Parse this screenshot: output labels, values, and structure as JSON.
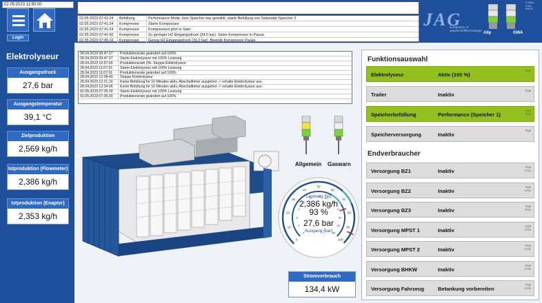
{
  "header": {
    "datetime": "02.05.2023 11:50:00",
    "login_label": "Login",
    "logo_text": "JAG",
    "logo_subtitle": "kompetenz in wasserstofftechnologie",
    "light_labels": [
      "Allp",
      "GWA"
    ],
    "status_tiny": "0.0Sec\n0.0m\nKSG3"
  },
  "top_log": [
    {
      "time": "02.05.2023 07:41:24",
      "source": "Befüllung",
      "message": "Performance Mode, kein Speicher war gewählt, starte Befüllung von Sekundär-Speicher 2"
    },
    {
      "time": "02.05.2023 07:41:24",
      "source": "Kompressor",
      "message": "Starte Kompressor"
    },
    {
      "time": "02.05.2023 07:41:24",
      "source": "Kompressor",
      "message": "Kompression jetzt in Start"
    },
    {
      "time": "02.05.2023 07:41:50",
      "source": "Kompressor",
      "message": "Zu geringer H2 Eingangsdruck (24,0 bar). Setze Kompressor in Pause."
    },
    {
      "time": "02.05.2023 07:45:16",
      "source": "Kompressor",
      "message": "Genug H2 Eingangsdruck (31,0 bar). Beende Kompressor Pause."
    }
  ],
  "left": {
    "title": "Elektrolyseur",
    "measures": [
      {
        "label": "Ausgangsdruck",
        "value": "27,6 bar"
      },
      {
        "label": "Ausgangstemperatur",
        "value": "39,1 °C"
      },
      {
        "label": "Zielproduktion",
        "value": "2,569 kg/h"
      },
      {
        "label": "Istproduktion (Flowmeter)",
        "value": "2,386 kg/h"
      },
      {
        "label": "Istproduktion (Enapter)",
        "value": "2,353 kg/h"
      }
    ]
  },
  "main_log": [
    {
      "time": "28.04.2023 09:47:37",
      "message": "Produktionsrate geändert auf 100%"
    },
    {
      "time": "28.04.2023 09:47:37",
      "message": "Starte Elektrolyseur mit 100% Leistung"
    },
    {
      "time": "28.04.2023 10:57:55",
      "message": "Produktionsrate 0%. Stoppe Elektrolyseur"
    },
    {
      "time": "28.04.2023 11:07:01",
      "message": "Starte Elektrolyseur mit 100% Leistung"
    },
    {
      "time": "28.04.2023 11:07:01",
      "message": "Produktionsrate geändert auf 100%"
    },
    {
      "time": "28.04.2023 12:08:40",
      "message": "Stoppe Elektrolyseur"
    },
    {
      "time": "28.04.2023 12:21:16",
      "message": "Keine Befüllung für 10 Minuten aktiv, Abschalttimer ausgelöst -> schalte Elektrolyseur aus."
    },
    {
      "time": "28.04.2023 12:34:06",
      "message": "Keine Befüllung für 10 Minuten aktiv, Abschalttimer ausgelöst -> schalte Elektrolyseur aus."
    },
    {
      "time": "02.05.2023 07:35:30",
      "message": "Starte Elektrolyseur mit 100% Leistung"
    },
    {
      "time": "02.05.2023 07:35:30",
      "message": "Produktionsrate geändert auf 100%"
    }
  ],
  "lamps": {
    "labels": [
      "Allgemein",
      "Gaswarn"
    ]
  },
  "gauge": {
    "leistung_label": "Leistung [%]",
    "flow_value": "2,386 kg/h",
    "percent_value": "93 %",
    "pressure_value": "27,6 bar",
    "ausgang_label": "Ausgang [bar]",
    "outer_ticks": [
      "0",
      "10",
      "20",
      "30",
      "40",
      "50",
      "60",
      "70",
      "80",
      "90",
      "100"
    ],
    "inner_ticks": [
      "0",
      "3",
      "6",
      "9",
      "12",
      "15",
      "18",
      "21",
      "24",
      "27",
      "30",
      "33",
      "36"
    ],
    "percent_level": 93,
    "pressure_level": 27.6,
    "pressure_max": 36
  },
  "strom": {
    "label": "Stromverbrauch",
    "value": "134,4 kW"
  },
  "functions": {
    "title": "Funktionsauswahl",
    "rows": [
      {
        "name": "Elektrolyseur",
        "status": "Aktiv (100 %)",
        "tag": "RQ3",
        "active": true
      },
      {
        "name": "Trailer",
        "status": "Inaktiv",
        "tag": "RQ8",
        "active": false
      },
      {
        "name": "Speicherbefüllung",
        "status": "Performance (Speicher 1)",
        "tag": "RQ3\nRQ3",
        "active": true
      },
      {
        "name": "Speicherversorgung",
        "status": "Inaktiv",
        "tag": "RQ8",
        "active": false
      }
    ]
  },
  "consumers": {
    "title": "Endverbraucher",
    "rows": [
      {
        "name": "Versorgung BZ1",
        "status": "Inaktiv",
        "tag": "RQ8\nST92"
      },
      {
        "name": "Versorgung BZ2",
        "status": "Inaktiv",
        "tag": "RQ8\nST92"
      },
      {
        "name": "Versorgung BZ3",
        "status": "Inaktiv",
        "tag": "RQ8\nST92"
      },
      {
        "name": "Versorgung MPST 1",
        "status": "Inaktiv",
        "tag": "RQ8\nST92"
      },
      {
        "name": "Versorgung MPST 2",
        "status": "Inaktiv",
        "tag": "RQ8\nST92"
      },
      {
        "name": "Versorgung BHKW",
        "status": "Inaktiv",
        "tag": "RQ8\nST90"
      },
      {
        "name": "Versorgung Fahrzeug",
        "status": "Betankung vorbereiten",
        "tag": "RQ8\nST90"
      }
    ]
  }
}
